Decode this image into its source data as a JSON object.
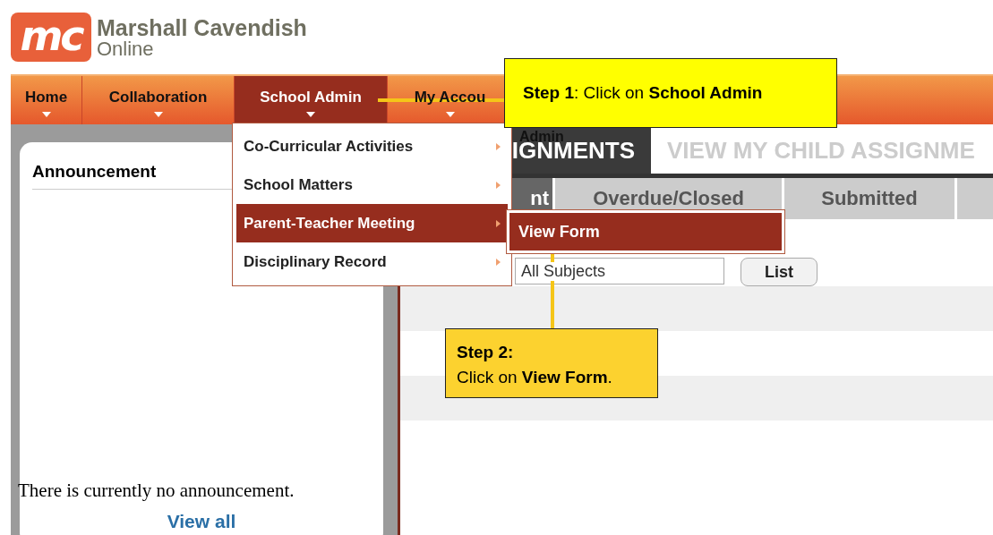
{
  "logo": {
    "mark": "mc",
    "name": "Marshall Cavendish",
    "subname": "Online"
  },
  "nav": [
    {
      "label": "Home",
      "selected": false
    },
    {
      "label": "Collaboration",
      "selected": false
    },
    {
      "label": "School Admin",
      "selected": true
    },
    {
      "label": "My Accou",
      "selected": false
    }
  ],
  "menu": {
    "items": [
      {
        "label": "Co-Curricular Activities",
        "selected": false
      },
      {
        "label": "School Matters",
        "selected": false
      },
      {
        "label": "Parent-Teacher Meeting",
        "selected": true
      },
      {
        "label": "Disciplinary Record",
        "selected": false
      }
    ],
    "submenu": [
      {
        "label": "View Form",
        "selected": true
      }
    ]
  },
  "announcement": {
    "title": "Announcement",
    "message": "There is currently no announcement.",
    "link": "View all"
  },
  "main_tabs": [
    {
      "label": "IGNMENTS",
      "selected": true
    },
    {
      "label": "VIEW MY CHILD ASSIGNME",
      "selected": false
    }
  ],
  "sub_tabs": [
    {
      "label": "nt",
      "selected": true
    },
    {
      "label": "Overdue/Closed",
      "selected": false
    },
    {
      "label": "Submitted",
      "selected": false
    },
    {
      "selected": false
    }
  ],
  "filter": {
    "subject": "All Subjects",
    "button": "List"
  },
  "overlay_label": "Admin",
  "callouts": [
    {
      "kind": "step1",
      "text": "**Step 1**: Click on **School Admin**"
    },
    {
      "kind": "step2",
      "title": "Step 2:",
      "text": "Click on **View Form**."
    }
  ]
}
